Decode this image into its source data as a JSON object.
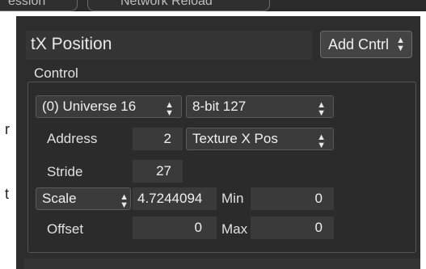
{
  "top_tabs": [
    "ession",
    "Network Reload"
  ],
  "left_side_chars": [
    "r",
    "t"
  ],
  "header": {
    "title": "tX Position",
    "add_control_label": "Add Cntrl"
  },
  "section": {
    "label": "Control"
  },
  "universe_select": {
    "value": "(0) Universe 16"
  },
  "bit_select": {
    "value": "8-bit 127"
  },
  "address": {
    "label": "Address",
    "value": "2"
  },
  "texture_select": {
    "value": "Texture X Pos"
  },
  "stride": {
    "label": "Stride",
    "value": "27"
  },
  "scale_select": {
    "value": "Scale"
  },
  "scale_value": "4.7244094",
  "min": {
    "label": "Min",
    "value": "0"
  },
  "offset": {
    "label": "Offset",
    "value": "0"
  },
  "max": {
    "label": "Max",
    "value": "0"
  }
}
